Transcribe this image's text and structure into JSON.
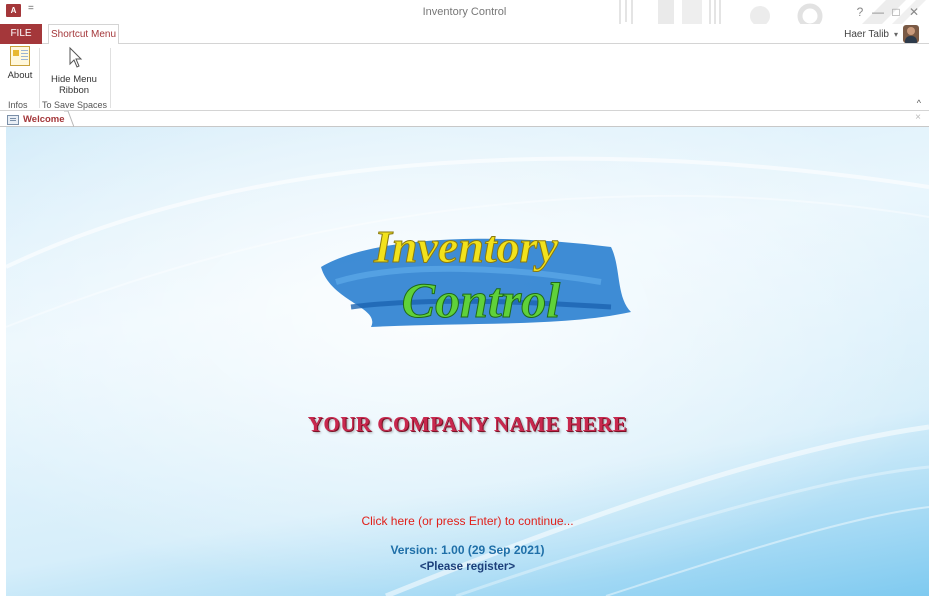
{
  "window": {
    "title": "Inventory Control",
    "app_icon_letter": "A",
    "qat_glyph": "=",
    "help": "?",
    "minimize": "—",
    "restore": "□",
    "close": "✕"
  },
  "tabs": {
    "file": "FILE",
    "shortcut_menu": "Shortcut Menu"
  },
  "user": {
    "name": "Haer Talib",
    "caret": "▾"
  },
  "ribbon": {
    "about_label": "About",
    "hide_label_line1": "Hide Menu",
    "hide_label_line2": "Ribbon",
    "group_infos": "Infos",
    "group_save": "To Save Spaces",
    "collapse_glyph": "^"
  },
  "document": {
    "tab_label": "Welcome",
    "close_glyph": "×"
  },
  "form": {
    "logo_line1": "Inventory",
    "logo_line2": "Control",
    "company": "YOUR COMPANY NAME HERE",
    "continue_text": "Click here (or press Enter) to continue...",
    "version": "Version: 1.00 (29 Sep 2021)",
    "register": "<Please register>"
  },
  "colors": {
    "access_red": "#a4373a",
    "company_red": "#c8284e",
    "continue_red": "#e0201a",
    "version_blue": "#1f6fa8",
    "register_navy": "#1c3f7a",
    "logo_yellow": "#f2e21c",
    "logo_green": "#5fd13a",
    "logo_brush_blue": "#2a7fd0"
  },
  "icons": {
    "app": "access-icon",
    "about": "about-icon",
    "hide_ribbon": "pointer-icon",
    "form": "form-icon",
    "avatar": "user-avatar"
  }
}
